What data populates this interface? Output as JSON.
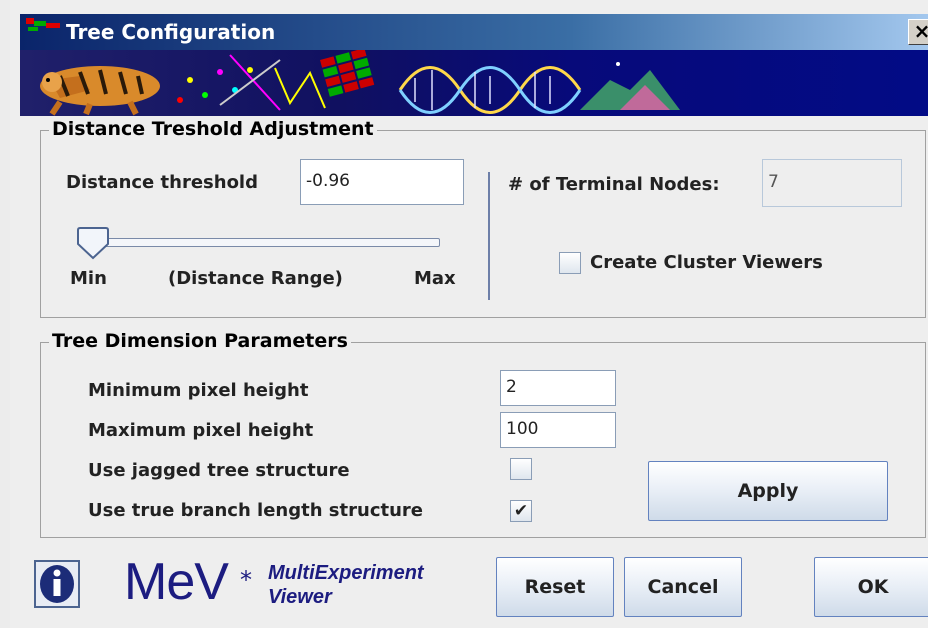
{
  "window": {
    "title": "Tree Configuration",
    "close_glyph": "×"
  },
  "distance": {
    "group_title": "Distance Treshold Adjustment",
    "threshold_label": "Distance threshold",
    "threshold_value": "-0.96",
    "slider_min_label": "Min",
    "slider_range_label": "(Distance Range)",
    "slider_max_label": "Max",
    "slider_position": 0,
    "terminal_nodes_label": "# of Terminal Nodes:",
    "terminal_nodes_value": "7",
    "create_cluster_viewers_label": "Create Cluster Viewers",
    "create_cluster_viewers_checked": false
  },
  "dimension": {
    "group_title": "Tree Dimension Parameters",
    "min_height_label": "Minimum pixel height",
    "min_height_value": "2",
    "max_height_label": "Maximum pixel height",
    "max_height_value": "100",
    "jagged_label": "Use jagged tree structure",
    "jagged_checked": false,
    "true_branch_label": "Use true branch length structure",
    "true_branch_checked": true,
    "true_branch_mark": "✔",
    "apply_label": "Apply"
  },
  "footer": {
    "logo_text": "MeV",
    "logo_star": "*",
    "logo_sub_1": "MultiExperiment",
    "logo_sub_2": "Viewer",
    "info_icon": "info-icon",
    "reset_label": "Reset",
    "cancel_label": "Cancel",
    "ok_label": "OK"
  },
  "colors": {
    "title_bar": "#0a246a",
    "banner": "#020b86",
    "logo": "#1c1c80"
  }
}
